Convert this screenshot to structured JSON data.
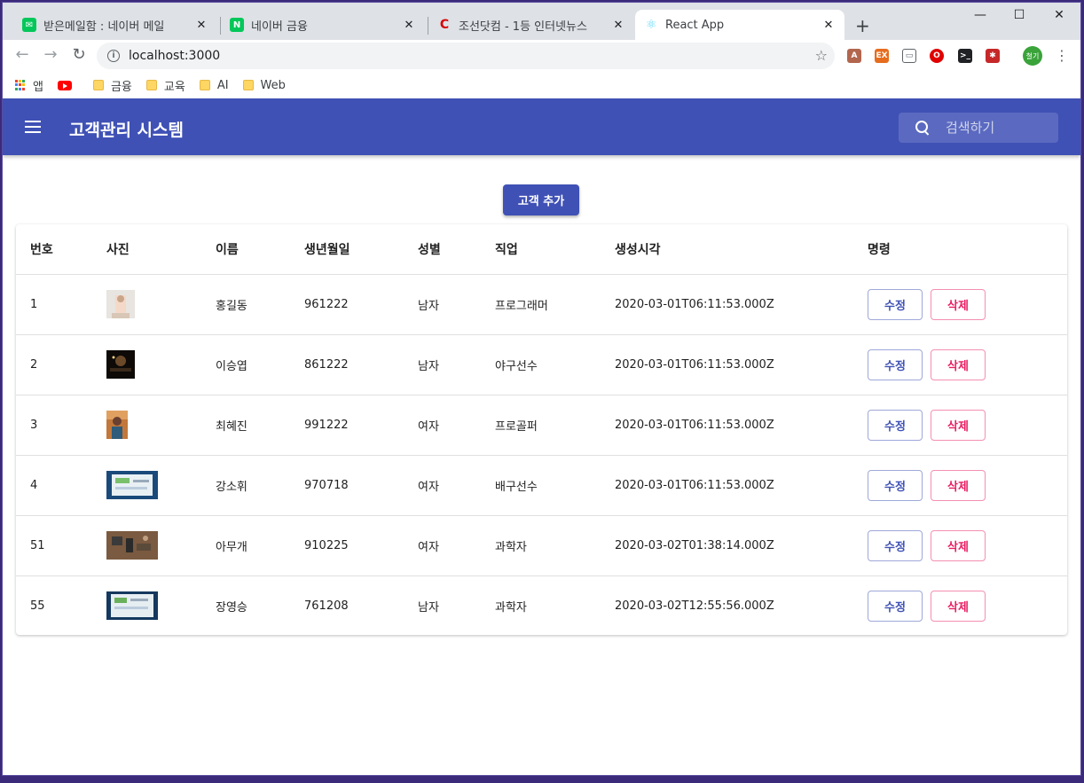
{
  "browser": {
    "tabs": [
      {
        "title": "받은메일함 : 네이버 메일",
        "favicon_color": "#03c75a"
      },
      {
        "title": "네이버 금융",
        "favicon_color": "#03c75a"
      },
      {
        "title": "조선닷컴 - 1등 인터넷뉴스",
        "favicon_color": "#d60000"
      },
      {
        "title": "React App",
        "favicon_color": "#61dafb"
      }
    ],
    "url": "localhost:3000",
    "profile_label": "철기",
    "bookmarks": [
      {
        "label": "앱",
        "icon": "apps-grid-icon"
      },
      {
        "label": "",
        "icon": "youtube-icon"
      },
      {
        "label": "금융",
        "icon": "folder-icon"
      },
      {
        "label": "교육",
        "icon": "folder-icon"
      },
      {
        "label": "AI",
        "icon": "folder-icon"
      },
      {
        "label": "Web",
        "icon": "folder-icon"
      }
    ]
  },
  "app": {
    "title": "고객관리 시스템",
    "search_placeholder": "검색하기",
    "add_button": "고객 추가",
    "accent_color": "#3f51b5",
    "headers": [
      "번호",
      "사진",
      "이름",
      "생년월일",
      "성별",
      "직업",
      "생성시각",
      "명령"
    ],
    "edit_label": "수정",
    "delete_label": "삭제",
    "customers": [
      {
        "id": "1",
        "name": "홍길동",
        "birthday": "961222",
        "gender": "남자",
        "job": "프로그래머",
        "created": "2020-03-01T06:11:53.000Z"
      },
      {
        "id": "2",
        "name": "이승엽",
        "birthday": "861222",
        "gender": "남자",
        "job": "야구선수",
        "created": "2020-03-01T06:11:53.000Z"
      },
      {
        "id": "3",
        "name": "최혜진",
        "birthday": "991222",
        "gender": "여자",
        "job": "프로골퍼",
        "created": "2020-03-01T06:11:53.000Z"
      },
      {
        "id": "4",
        "name": "강소휘",
        "birthday": "970718",
        "gender": "여자",
        "job": "배구선수",
        "created": "2020-03-01T06:11:53.000Z"
      },
      {
        "id": "51",
        "name": "아무개",
        "birthday": "910225",
        "gender": "여자",
        "job": "과학자",
        "created": "2020-03-02T01:38:14.000Z"
      },
      {
        "id": "55",
        "name": "장영승",
        "birthday": "761208",
        "gender": "남자",
        "job": "과학자",
        "created": "2020-03-02T12:55:56.000Z"
      }
    ]
  }
}
